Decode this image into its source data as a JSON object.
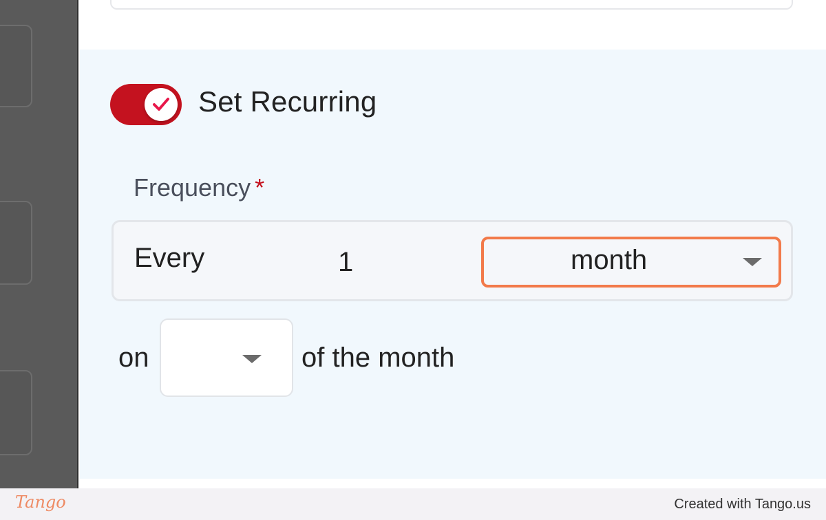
{
  "recurring": {
    "toggle_label": "Set Recurring",
    "enabled": true,
    "toggle_color": "#c4121f",
    "check_icon": "checkmark-icon"
  },
  "frequency": {
    "label": "Frequency",
    "required_marker": "*",
    "every_label": "Every",
    "interval_value": "1",
    "unit_value": "month",
    "highlight_color": "#f27a4a"
  },
  "day_of_month": {
    "prefix": "on",
    "value": "",
    "suffix": "of the month"
  },
  "footer": {
    "logo_text": "Tango",
    "credit": "Created with Tango.us"
  }
}
